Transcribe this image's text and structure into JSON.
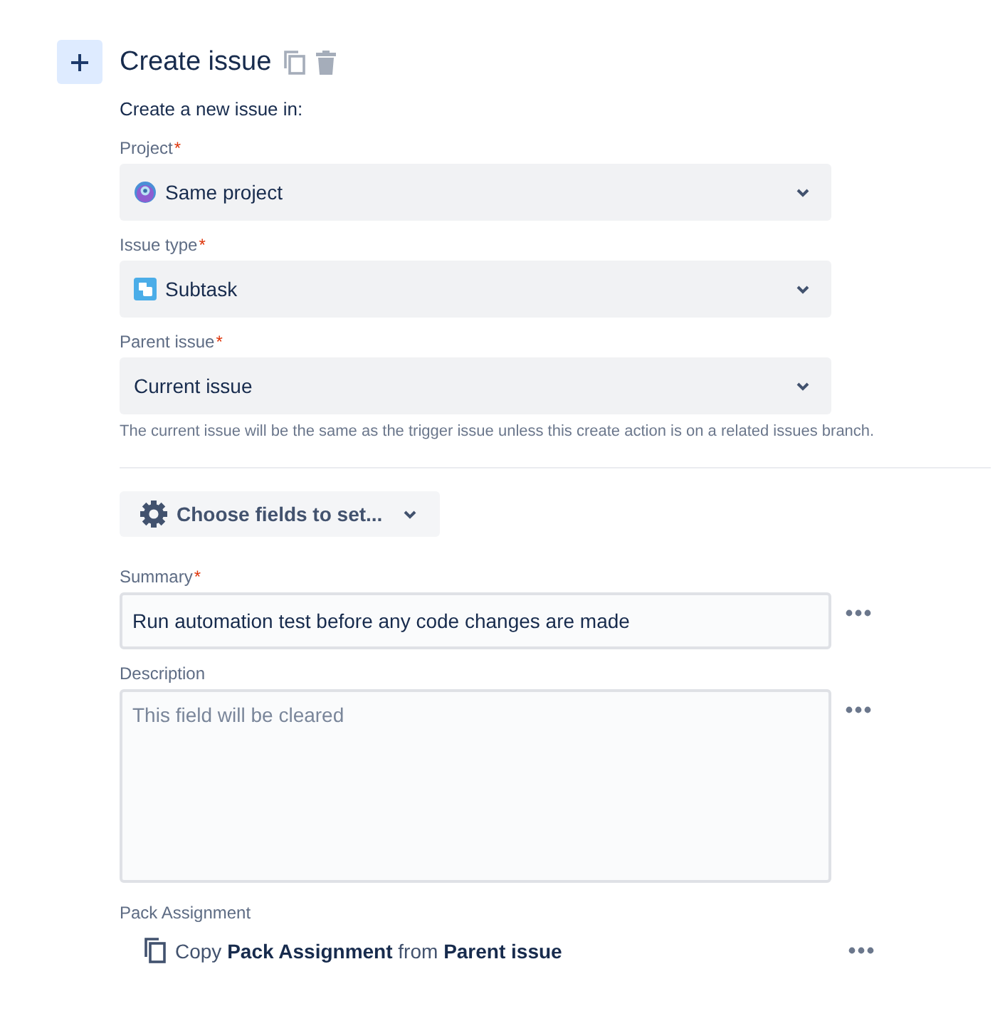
{
  "header": {
    "title": "Create issue",
    "subtitle": "Create a new issue in:"
  },
  "selects": [
    {
      "label": "Project",
      "required_mark": "*",
      "value": "Same project",
      "kind": "project"
    },
    {
      "label": "Issue type",
      "required_mark": "*",
      "value": "Subtask",
      "kind": "subtask"
    },
    {
      "label": "Parent issue",
      "required_mark": "*",
      "value": "Current issue",
      "kind": "plain"
    }
  ],
  "help_text": "The current issue will be the same as the trigger issue unless this create action is on a related issues branch.",
  "choose_fields_button": "Choose fields to set...",
  "summary": {
    "label": "Summary",
    "required_mark": "*",
    "value": "Run automation test before any code changes are made"
  },
  "description": {
    "label": "Description",
    "placeholder": "This field will be cleared"
  },
  "pack_assignment": {
    "label": "Pack Assignment",
    "text": "Copy **Pack Assignment** from **Parent issue**"
  }
}
